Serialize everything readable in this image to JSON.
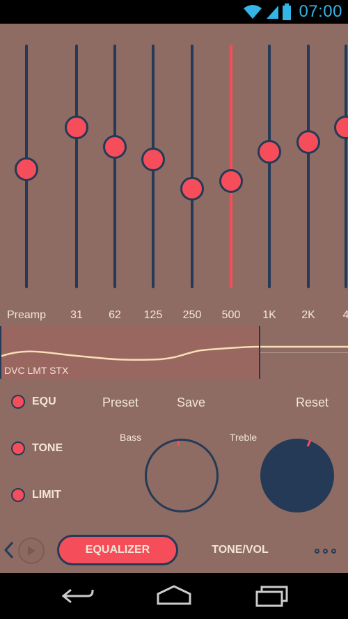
{
  "status_bar": {
    "time": "07:00",
    "icons": [
      "wifi-icon",
      "signal-icon",
      "battery-icon"
    ],
    "accent": "#33b5e5"
  },
  "equalizer": {
    "active_band": "500",
    "bands": [
      {
        "label": "Preamp",
        "level": 0.49
      },
      {
        "label": "31",
        "level": 0.66
      },
      {
        "label": "62",
        "level": 0.58
      },
      {
        "label": "125",
        "level": 0.53
      },
      {
        "label": "250",
        "level": 0.41
      },
      {
        "label": "500",
        "level": 0.44
      },
      {
        "label": "1K",
        "level": 0.56
      },
      {
        "label": "2K",
        "level": 0.6
      },
      {
        "label": "4",
        "level": 0.66
      }
    ]
  },
  "curve_panel": {
    "label": "DVC LMT STX"
  },
  "controls": {
    "toggles": [
      {
        "label": "EQU",
        "on": true
      },
      {
        "label": "TONE",
        "on": true
      },
      {
        "label": "LIMIT",
        "on": true
      }
    ],
    "preset_label": "Preset",
    "save_label": "Save",
    "reset_label": "Reset"
  },
  "tone": {
    "bass_label": "Bass",
    "treble_label": "Treble",
    "bass_level": 0.0,
    "treble_level": 1.0
  },
  "bottom_bar": {
    "equalizer_tab": "EQUALIZER",
    "tone_vol_tab": "TONE/VOL"
  },
  "colors": {
    "background": "#8e6c63",
    "accent": "#f54e5a",
    "navy": "#243a56",
    "text": "#f3e6d6"
  }
}
